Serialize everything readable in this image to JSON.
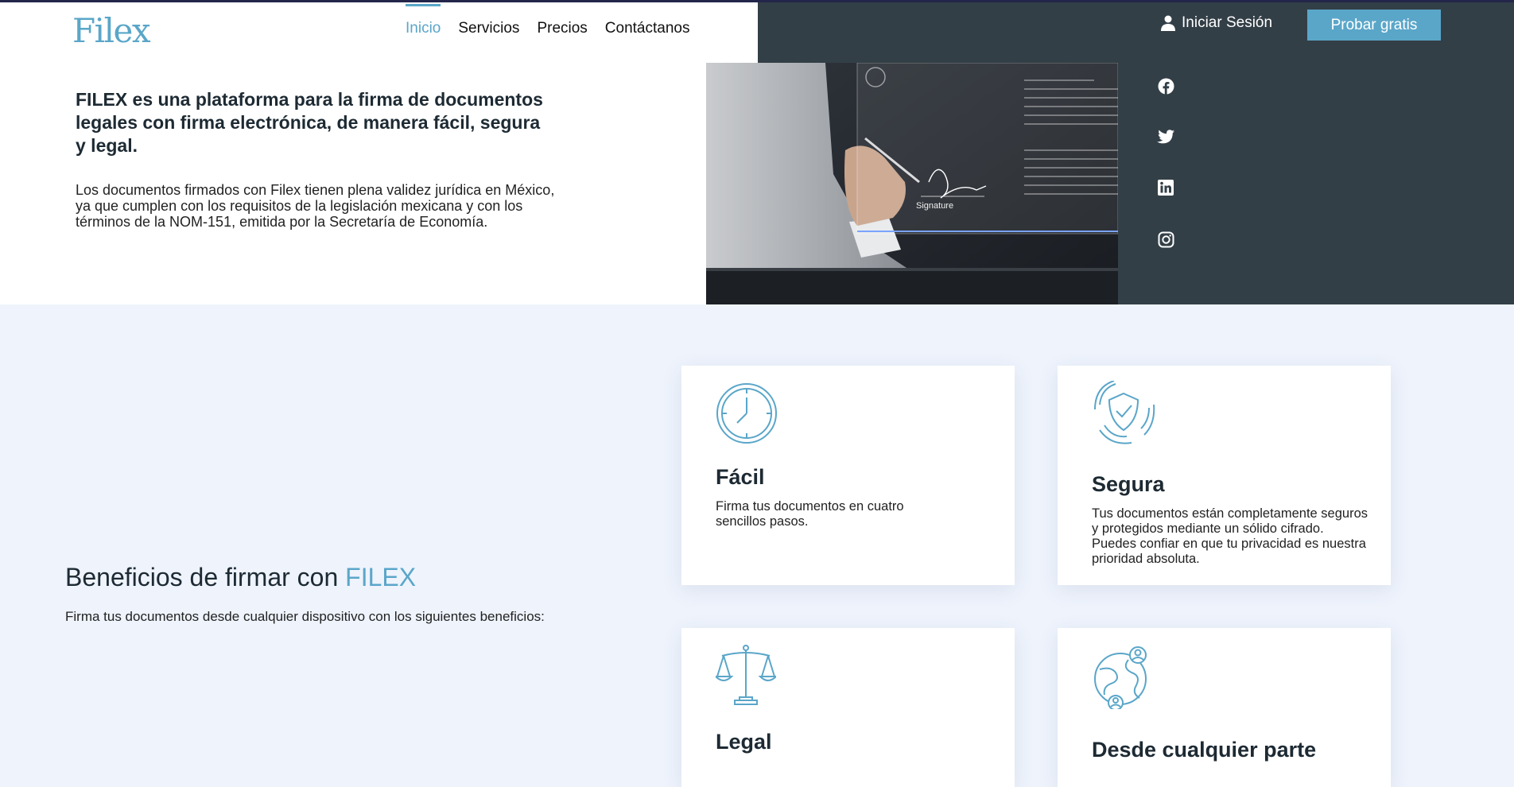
{
  "header": {
    "logo": "Filex",
    "nav": [
      {
        "label": "Inicio",
        "active": true
      },
      {
        "label": "Servicios",
        "active": false
      },
      {
        "label": "Precios",
        "active": false
      },
      {
        "label": "Contáctanos",
        "active": false
      }
    ],
    "login_label": "Iniciar Sesión",
    "cta_label": "Probar gratis"
  },
  "hero": {
    "title": "FILEX es una plataforma para la firma de documentos legales con firma electrónica, de manera fácil, segura y legal.",
    "text": "Los documentos firmados con Filex tienen plena validez jurídica en México, ya que cumplen con los requisitos de la legislación mexicana y con los términos de la NOM-151, emitida por la Secretaría de Economía.",
    "image_caption": "Signature"
  },
  "social": [
    "facebook-icon",
    "twitter-icon",
    "linkedin-icon",
    "instagram-icon"
  ],
  "benefits": {
    "title_prefix": "Beneficios de firmar con ",
    "title_accent": "FILEX",
    "subtitle": "Firma tus documentos desde cualquier dispositivo con los siguientes beneficios:",
    "cards": [
      {
        "title": "Fácil",
        "text": "Firma tus documentos en cuatro sencillos pasos.",
        "icon": "clock-icon"
      },
      {
        "title": "Segura",
        "text": "Tus documentos están completamente seguros y protegidos mediante un sólido cifrado. Puedes confiar en que tu privacidad es nuestra prioridad absoluta.",
        "icon": "shield-check-icon"
      },
      {
        "title": "Legal",
        "text": "",
        "icon": "scales-icon"
      },
      {
        "title": "Desde cualquier parte",
        "text": "",
        "icon": "globe-users-icon"
      }
    ]
  },
  "colors": {
    "accent": "#5aa6c9",
    "dark": "#333f47",
    "background": "#eef3fc"
  }
}
